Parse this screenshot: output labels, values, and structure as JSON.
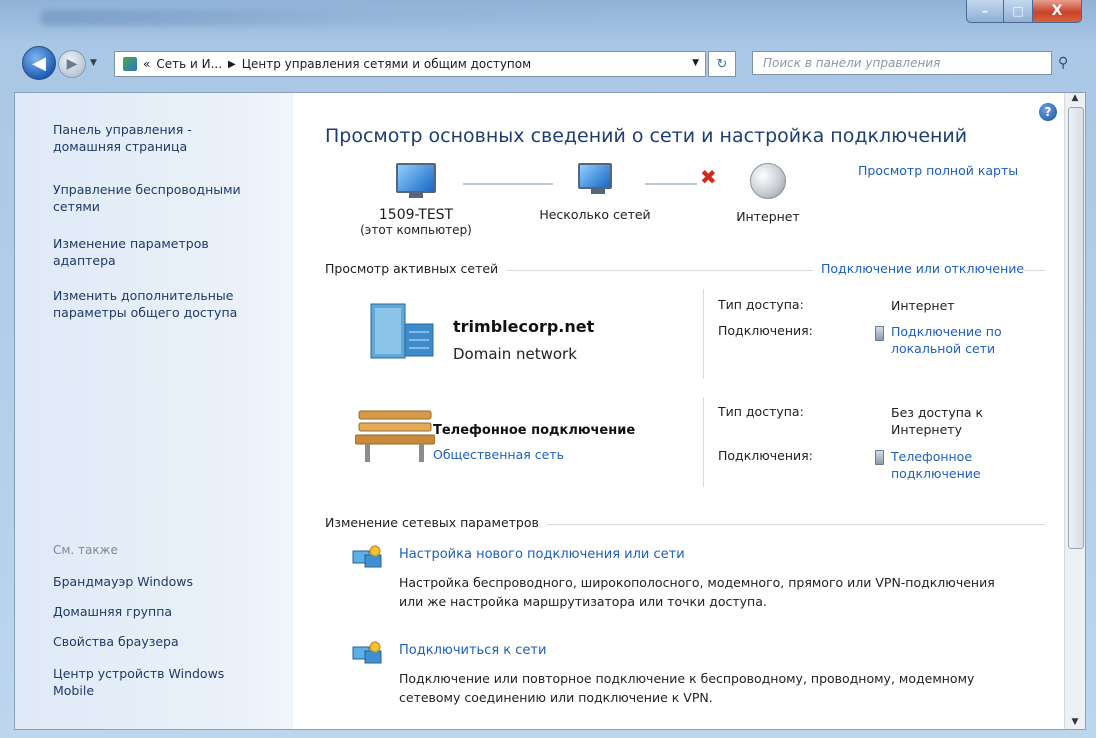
{
  "window": {
    "controls": {
      "minimize": "–",
      "maximize": "□",
      "close": "X"
    }
  },
  "nav": {
    "back_icon": "arrow-left",
    "forward_icon": "arrow-right",
    "back_glyph": "◀",
    "forward_glyph": "▶",
    "history_glyph": "▼",
    "breadcrumb_prefix": "«",
    "breadcrumb_1": "Сеть и И...",
    "breadcrumb_sep": "▶",
    "breadcrumb_2": "Центр управления сетями и общим доступом",
    "dropdown_glyph": "▼",
    "refresh_glyph": "↻",
    "search_placeholder": "Поиск в панели управления",
    "search_glyph": "⚲"
  },
  "left_pane": {
    "links": [
      "Панель управления - домашняя страница",
      "Управление беспроводными сетями",
      "Изменение параметров адаптера",
      "Изменить дополнительные параметры общего доступа"
    ],
    "see_also_label": "См. также",
    "see_also": [
      "Брандмауэр Windows",
      "Домашняя группа",
      "Свойства браузера",
      "Центр устройств Windows Mobile"
    ]
  },
  "main": {
    "title": "Просмотр основных сведений о сети и настройка подключений",
    "full_map_link": "Просмотр полной карты",
    "map": {
      "computer_name": "1509-TEST",
      "computer_sub": "(этот компьютер)",
      "networks_label": "Несколько сетей",
      "internet_label": "Интернет",
      "broken_link_glyph": "✖"
    },
    "active_networks_label": "Просмотр активных сетей",
    "connect_disconnect_link": "Подключение или отключение",
    "networks": [
      {
        "name": "trimblecorp.net",
        "type": "Domain network",
        "access_label": "Тип доступа:",
        "access_value": "Интернет",
        "connections_label": "Подключения:",
        "connection_link": "Подключение по локальной сети"
      },
      {
        "name": "Телефонное подключение",
        "type": "Общественная сеть",
        "access_label": "Тип доступа:",
        "access_value": "Без доступа к Интернету",
        "connections_label": "Подключения:",
        "connection_link": "Телефонное подключение"
      }
    ],
    "change_settings_label": "Изменение сетевых параметров",
    "tasks": [
      {
        "title": "Настройка нового подключения или сети",
        "description": "Настройка беспроводного, широкополосного, модемного, прямого или VPN-подключения или же настройка маршрутизатора или точки доступа."
      },
      {
        "title": "Подключиться к сети",
        "description": "Подключение или повторное подключение к беспроводному, проводному, модемному сетевому соединению или подключение к VPN."
      }
    ],
    "help_glyph": "?"
  },
  "scrollbar": {
    "up_glyph": "▲",
    "down_glyph": "▼"
  }
}
